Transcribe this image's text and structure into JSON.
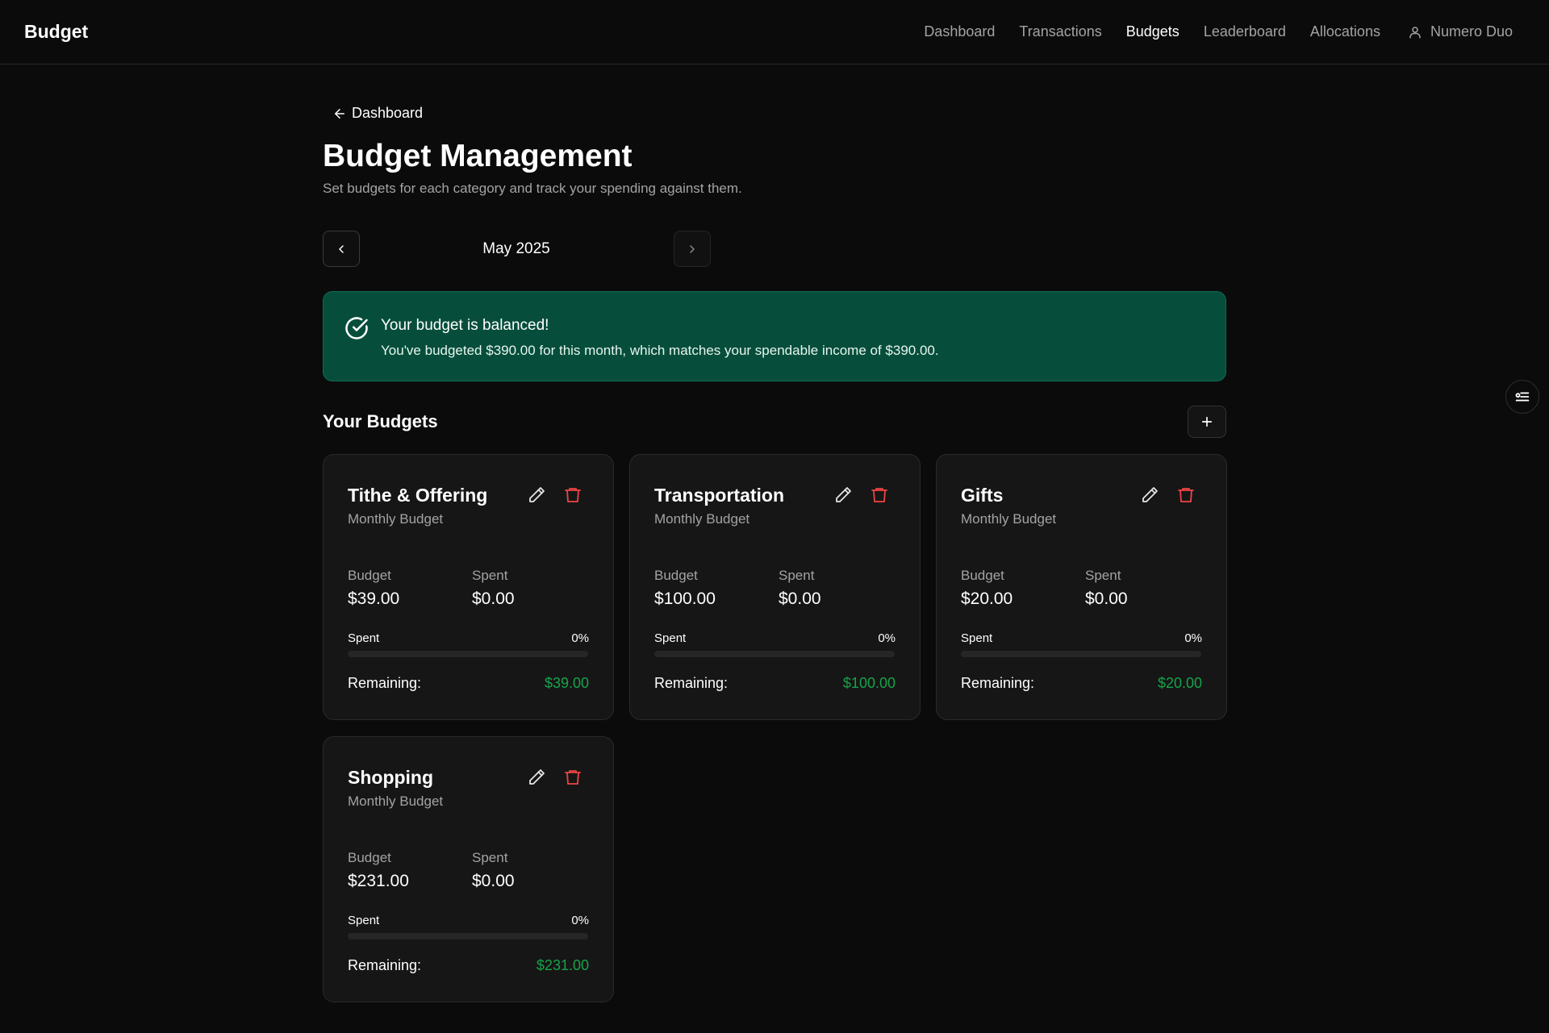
{
  "app": {
    "brand": "Budget"
  },
  "nav": {
    "links": [
      {
        "label": "Dashboard"
      },
      {
        "label": "Transactions"
      },
      {
        "label": "Budgets"
      },
      {
        "label": "Leaderboard"
      },
      {
        "label": "Allocations"
      }
    ],
    "active": "Budgets",
    "user": "Numero Duo"
  },
  "page": {
    "back_label": "Dashboard",
    "title": "Budget Management",
    "subtitle": "Set budgets for each category and track your spending against them."
  },
  "month": {
    "label": "May 2025"
  },
  "alert": {
    "title": "Your budget is balanced!",
    "text": "You've budgeted $390.00 for this month, which matches your spendable income of $390.00.",
    "color": "#064e3b"
  },
  "section": {
    "title": "Your Budgets"
  },
  "budgets": [
    {
      "name": "Tithe & Offering",
      "period": "Monthly Budget",
      "budget_label": "Budget",
      "budget": "$39.00",
      "spent_label": "Spent",
      "spent": "$0.00",
      "progress_label": "Spent",
      "progress_pct": "0%",
      "progress_value": 0,
      "remaining_label": "Remaining:",
      "remaining": "$39.00"
    },
    {
      "name": "Transportation",
      "period": "Monthly Budget",
      "budget_label": "Budget",
      "budget": "$100.00",
      "spent_label": "Spent",
      "spent": "$0.00",
      "progress_label": "Spent",
      "progress_pct": "0%",
      "progress_value": 0,
      "remaining_label": "Remaining:",
      "remaining": "$100.00"
    },
    {
      "name": "Gifts",
      "period": "Monthly Budget",
      "budget_label": "Budget",
      "budget": "$20.00",
      "spent_label": "Spent",
      "spent": "$0.00",
      "progress_label": "Spent",
      "progress_pct": "0%",
      "progress_value": 0,
      "remaining_label": "Remaining:",
      "remaining": "$20.00"
    },
    {
      "name": "Shopping",
      "period": "Monthly Budget",
      "budget_label": "Budget",
      "budget": "$231.00",
      "spent_label": "Spent",
      "spent": "$0.00",
      "progress_label": "Spent",
      "progress_pct": "0%",
      "progress_value": 0,
      "remaining_label": "Remaining:",
      "remaining": "$231.00"
    }
  ],
  "colors": {
    "background": "#0b0b0b",
    "card": "#161616",
    "success": "#16a34a",
    "danger": "#ef4444"
  },
  "icons": {
    "back": "arrow-left-icon",
    "user": "user-icon",
    "prev": "chevron-left-icon",
    "next": "chevron-right-icon",
    "check": "check-circle-icon",
    "add": "plus-icon",
    "edit": "pencil-icon",
    "delete": "trash-icon",
    "float": "list-filter-icon"
  }
}
